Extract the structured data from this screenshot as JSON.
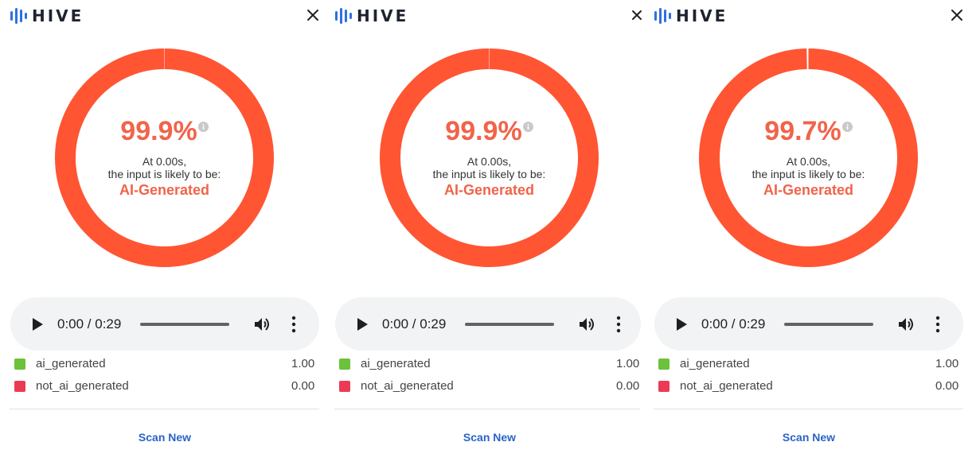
{
  "brand": {
    "name": "HIVE",
    "mark_color": "#2f6fe4"
  },
  "colors": {
    "ai_generated_ring": "#ff5533",
    "not_ai_generated_ring": "#ffffff",
    "accent_text": "#f0644a",
    "link": "#2a63c7",
    "swatch_ai_generated": "#6cc23a",
    "swatch_not_ai_generated": "#ec3a55"
  },
  "panels": [
    {
      "score": "99.9%",
      "score_fraction": 0.999,
      "at_text": "At 0.00s,",
      "likely_text": "the input is likely to be:",
      "verdict": "AI-Generated",
      "player": {
        "time": "0:00 / 0:29",
        "progress": 0
      },
      "legend": [
        {
          "label": "ai_generated",
          "value": "1.00"
        },
        {
          "label": "not_ai_generated",
          "value": "0.00"
        }
      ],
      "scan_new": "Scan New"
    },
    {
      "score": "99.9%",
      "score_fraction": 0.999,
      "at_text": "At 0.00s,",
      "likely_text": "the input is likely to be:",
      "verdict": "AI-Generated",
      "player": {
        "time": "0:00 / 0:29",
        "progress": 0
      },
      "legend": [
        {
          "label": "ai_generated",
          "value": "1.00"
        },
        {
          "label": "not_ai_generated",
          "value": "0.00"
        }
      ],
      "scan_new": "Scan New"
    },
    {
      "score": "99.7%",
      "score_fraction": 0.997,
      "at_text": "At 0.00s,",
      "likely_text": "the input is likely to be:",
      "verdict": "AI-Generated",
      "player": {
        "time": "0:00 / 0:29",
        "progress": 0
      },
      "legend": [
        {
          "label": "ai_generated",
          "value": "1.00"
        },
        {
          "label": "not_ai_generated",
          "value": "0.00"
        }
      ],
      "scan_new": "Scan New"
    }
  ],
  "icons": {
    "logo": "hive-logo-icon",
    "close": "close-icon",
    "info": "info-icon",
    "play": "play-icon",
    "volume": "volume-icon",
    "more": "more-vertical-icon"
  }
}
